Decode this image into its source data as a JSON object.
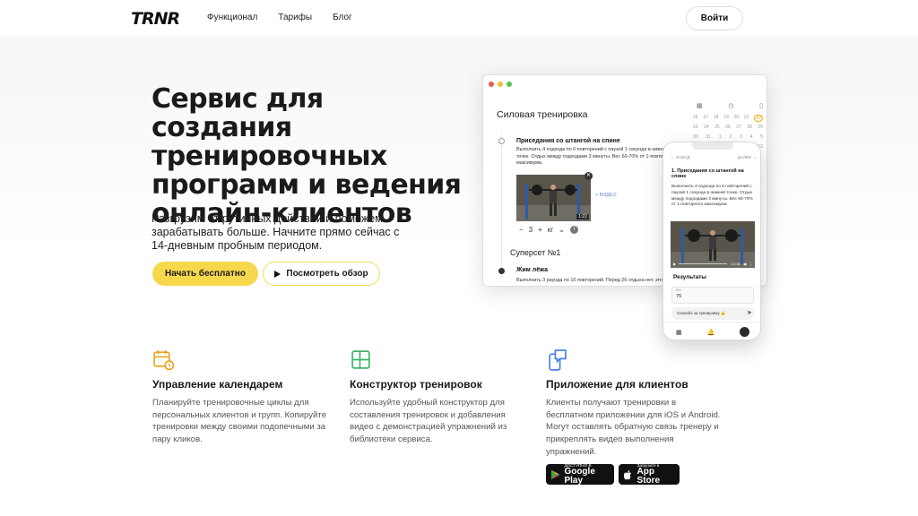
{
  "header": {
    "logo": "TRNR",
    "nav": [
      "Функционал",
      "Тарифы",
      "Блог"
    ],
    "login_label": "Войти"
  },
  "hero": {
    "title": "Сервис для создания тренировочных программ и ведения онлайн-клиентов",
    "subtitle": "Разгрузим от рутинных действий и поможем зарабатывать больше. Начните прямо сейчас с 14-дневным пробным периодом.",
    "cta_primary": "Начать бесплатно",
    "cta_secondary": "Посмотреть обзор"
  },
  "desktop_mockup": {
    "workout_title": "Силовая тренировка",
    "exercise_name": "Приседания со штангой на спине",
    "exercise_desc": "Выполнить 4 подхода по 6 повторений с паузой 1 секунда в нижней точке. Отдых между подходами 3 минуты. Вес 60-70% от 1-повторного максимума.",
    "video_duration": "1:22",
    "video_link": "+ ВИДЕО",
    "stepper_value": "3",
    "stepper_unit": "кг",
    "superset_label": "Суперсет №1",
    "exercise2_name": "Жим лёжа",
    "exercise2_desc": "Выполнить 3 раунда по 10 повторений. Перед 2б отдыха нет, это",
    "calendar_rows": [
      [
        "16",
        "17",
        "18",
        "19",
        "20",
        "21",
        "22"
      ],
      [
        "23",
        "24",
        "25",
        "26",
        "27",
        "28",
        "29"
      ],
      [
        "30",
        "31",
        "1",
        "2",
        "3",
        "4",
        "5"
      ],
      [
        "6",
        "7",
        "8",
        "9",
        "10",
        "11",
        "12"
      ]
    ]
  },
  "phone_mockup": {
    "nav_back": "← НАЗАД",
    "nav_next": "ДАЛЕЕ →",
    "exercise_title": "1. Приседания со штангой на спине",
    "exercise_desc": "Выполнить 4 подхода по 6 повторений с паузой 1 секунда в нижней точке. Отдых между подходами 3 минуты. Вес 60-70% от 1-повторного максимума.",
    "video_time": "-12:36",
    "results_label": "Результаты",
    "results_caption": "Вес",
    "results_value": "75",
    "chat_text": "Спасибо за тренировку 👍"
  },
  "features": [
    {
      "title": "Управление календарем",
      "text": "Планируйте тренировочные циклы для персональных клиентов и групп. Копируйте тренировки между своими подопечными за пару кликов.",
      "icon": "calendar-clock-icon"
    },
    {
      "title": "Конструктор тренировок",
      "text": "Используйте удобный конструктор для составления тренировок и добавления видео с демонстрацией упражнений из библиотеки сервиса.",
      "icon": "grid-builder-icon"
    },
    {
      "title": "Приложение для клиентов",
      "text": "Клиенты получают тренировки в бесплатном приложении для iOS и Android. Могут оставлять обратную связь тренеру и прикреплять видео выполнения упражнений.",
      "icon": "phone-chat-icon"
    }
  ],
  "stores": {
    "google_small": "ДОСТУПНО В",
    "google_big": "Google Play",
    "apple_small": "Загрузите в",
    "apple_big": "App Store"
  },
  "colors": {
    "accent": "#f7d84c",
    "icon_orange": "#e8a317",
    "icon_green": "#3db36b",
    "icon_blue": "#3b7be8"
  }
}
